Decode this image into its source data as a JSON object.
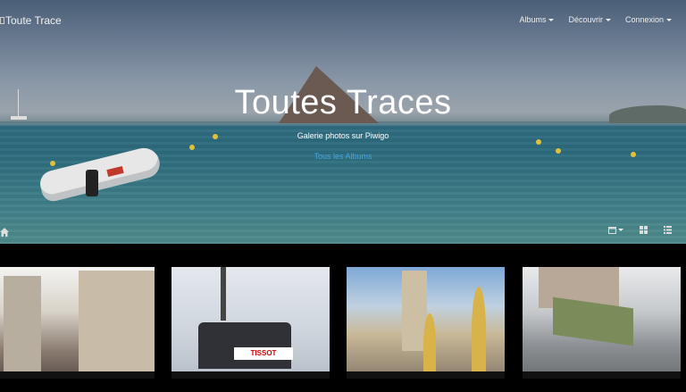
{
  "brand": {
    "logo_alt": "Toute Trace"
  },
  "nav": {
    "items": [
      {
        "label": "Albums"
      },
      {
        "label": "Découvrir"
      },
      {
        "label": "Connexion"
      }
    ]
  },
  "hero": {
    "title": "Toutes Traces",
    "subtitle": "Galerie photos sur Piwigo",
    "cta": "Tous les Albums"
  },
  "thumbnails": [
    {
      "icon": "street-photo"
    },
    {
      "icon": "cable-car-photo",
      "sign": "TISSOT"
    },
    {
      "icon": "church-photo"
    },
    {
      "icon": "tram-photo"
    }
  ],
  "colors": {
    "accent": "#4aa3df",
    "background": "#000000"
  }
}
